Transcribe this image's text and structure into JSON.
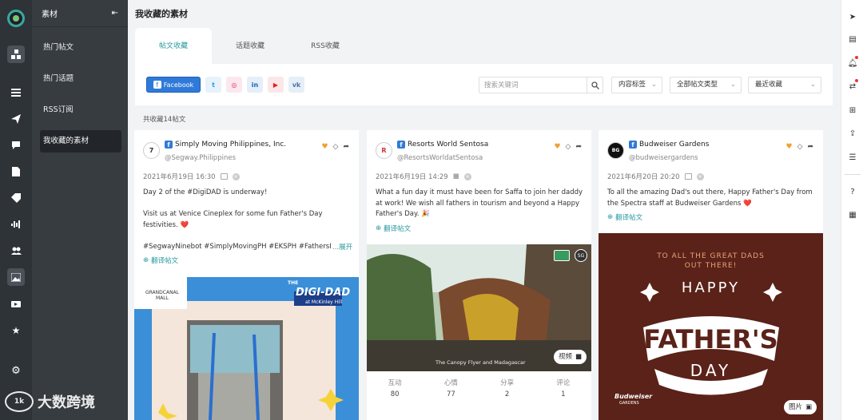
{
  "sidebar": {
    "title": "素材",
    "items": [
      {
        "label": "热门帖文"
      },
      {
        "label": "热门话题"
      },
      {
        "label": "RSS订阅"
      },
      {
        "label": "我收藏的素材"
      }
    ]
  },
  "page": {
    "title": "我收藏的素材",
    "tabs": [
      {
        "label": "帖文收藏"
      },
      {
        "label": "话题收藏"
      },
      {
        "label": "RSS收藏"
      }
    ],
    "networks": {
      "facebook_label": "Facebook",
      "icons": [
        "twitter-icon",
        "instagram-icon",
        "linkedin-icon",
        "youtube-icon",
        "vk-icon"
      ]
    },
    "search": {
      "placeholder": "搜索关键词"
    },
    "filters": {
      "content_tag": "内容标签",
      "post_type": "全部帖文类型",
      "sort": "最近收藏"
    },
    "count": "共收藏14帖文",
    "translate_label": "翻译帖文",
    "expand_label": "...展开"
  },
  "cards": [
    {
      "name": "Simply Moving Philippines, Inc.",
      "handle": "@Segway.Philippines",
      "time": "2021年6月19日 16:30",
      "text": "Day 2 of the #DigiDAD is underway!\n\nVisit us at Venice Cineplex for some fun Father's Day festivities. ❤️\n\n#SegwayNinebot #SimplyMovingPH #EKSPH #FathersI",
      "media": {
        "label_top": "THE",
        "label_main": "DIGI-DAD",
        "label_sub": "at McKinley Hill",
        "mall": "GRANDCANAL MALL"
      }
    },
    {
      "name": "Resorts World Sentosa",
      "handle": "@ResortsWorldatSentosa",
      "time": "2021年6月19日 14:29",
      "text": "What a fun day it must have been for Saffa to join her daddy at work! We wish all fathers in tourism and beyond a Happy Father's Day. 🎉",
      "media": {
        "caption": "The Canopy Flyer and Madagascar",
        "badge": "视频",
        "tag": "SG"
      },
      "stats": [
        {
          "label": "互动",
          "value": "80"
        },
        {
          "label": "心情",
          "value": "77"
        },
        {
          "label": "分享",
          "value": "2"
        },
        {
          "label": "评论",
          "value": "1"
        }
      ]
    },
    {
      "name": "Budweiser Gardens",
      "handle": "@budweisergardens",
      "time": "2021年6月20日 20:20",
      "text": "To all the amazing Dad's out there, Happy Father's Day from the Spectra staff at Budweiser Gardens ❤️",
      "media": {
        "line1": "TO ALL THE GREAT DADS",
        "line2": "OUT THERE!",
        "happy": "HAPPY",
        "fathers": "FATHER'S",
        "day": "DAY",
        "brand": "Budweiser",
        "brand_sub": "GARDENS",
        "badge": "图片"
      }
    }
  ],
  "watermark": {
    "logo": "1k",
    "text": "大数跨境"
  }
}
